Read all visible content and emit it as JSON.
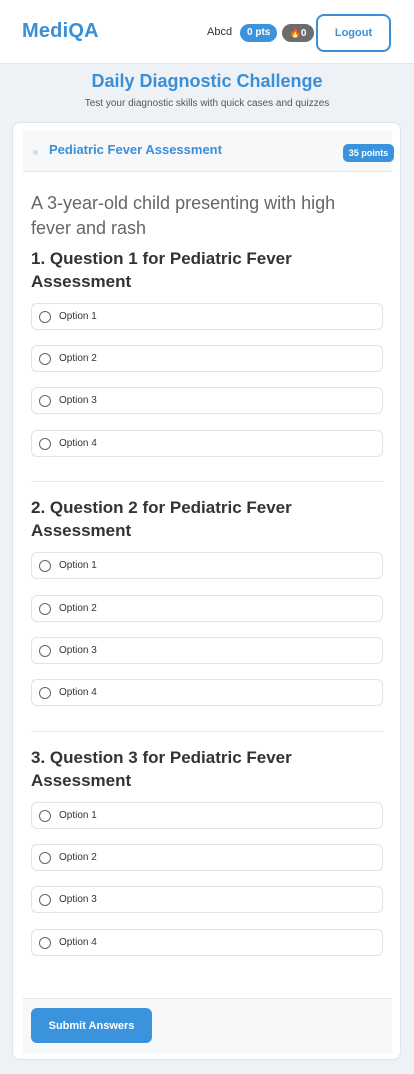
{
  "header": {
    "logo": "MediQA",
    "username": "Abcd",
    "points_badge": "0 pts",
    "streak_value": "0",
    "logout_label": "Logout"
  },
  "page": {
    "title": "Daily Diagnostic Challenge",
    "subtitle": "Test your diagnostic skills with quick cases and quizzes"
  },
  "case": {
    "title": "Pediatric Fever Assessment",
    "points": "35 points",
    "description": "A 3-year-old child presenting with high fever and rash"
  },
  "questions": [
    {
      "title": "1. Question 1 for Pediatric Fever Assessment",
      "options": [
        "Option 1",
        "Option 2",
        "Option 3",
        "Option 4"
      ]
    },
    {
      "title": "2. Question 2 for Pediatric Fever Assessment",
      "options": [
        "Option 1",
        "Option 2",
        "Option 3",
        "Option 4"
      ]
    },
    {
      "title": "3. Question 3 for Pediatric Fever Assessment",
      "options": [
        "Option 1",
        "Option 2",
        "Option 3",
        "Option 4"
      ]
    }
  ],
  "submit_label": "Submit Answers"
}
